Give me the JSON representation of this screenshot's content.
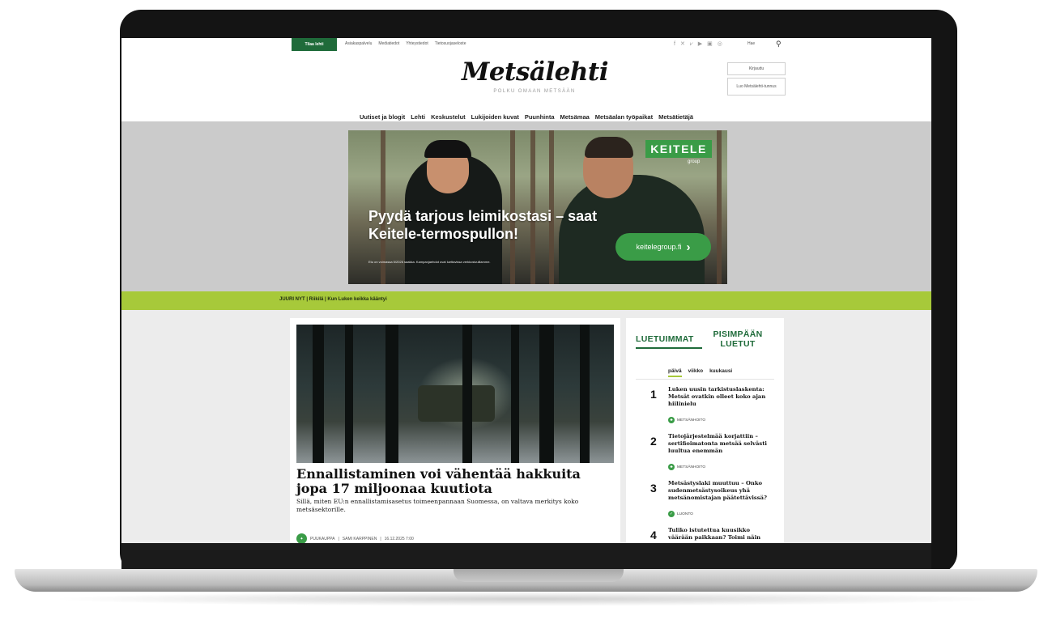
{
  "topbar": {
    "subscribe": "Tilaa lehti",
    "links": [
      "Asiakaspalvelu",
      "Mediatiedot",
      "Yhteystiedot",
      "Tietosuojaseloste"
    ],
    "social_icons": [
      "facebook-icon",
      "x-icon",
      "bluesky-icon",
      "youtube-icon",
      "linkedin-icon",
      "instagram-icon"
    ],
    "search_label": "Hae"
  },
  "header": {
    "logo": "Metsälehti",
    "tagline": "POLKU OMAAN METSÄÄN",
    "login": "Kirjaudu",
    "create_account": "Luo Metsälehti-tunnus"
  },
  "nav": [
    "Uutiset ja blogit",
    "Lehti",
    "Keskustelut",
    "Lukijoiden kuvat",
    "Puunhinta",
    "Metsämaa",
    "Metsäalan työpaikat",
    "Metsätietäjä"
  ],
  "ad": {
    "brand": "KEITELE",
    "brand_sub": "group",
    "headline": "Pyydä tarjous leimikostasi – saat Keitele-termospullon!",
    "fineprint": "Etu on voimassa 5/2026 saakka. Kampanjaehdot ovat luettavissa verkkosivuillamme.",
    "cta": "keitelegroup.fi",
    "accent": "#3a9c47"
  },
  "ticker": "JUURI NYT | Riikilä | Kun Luken keikka kääntyi",
  "article": {
    "title": "Ennallistaminen voi vähentää hakkuita jopa 17 miljoonaa kuutiota",
    "lead": "Sillä, miten EU:n ennallistamisasetus toimeenpannaan Suomessa, on valtava merkitys koko metsäsektorille.",
    "category": "PUUKAUPPA",
    "author": "SAMI KARPPINEN",
    "date": "16.12.2025 7:00"
  },
  "sidebar": {
    "tab_most_read": "LUETUIMMAT",
    "tab_longest_read": "PISIMPÄÄN LUETUT",
    "periods": [
      "päivä",
      "viikko",
      "kuukausi"
    ],
    "items": [
      {
        "num": "1",
        "title": "Luken uusin tarkistuslaskenta: Metsät ovatkin olleet koko ajan hiilinielu",
        "tag": "METSÄNHOITO"
      },
      {
        "num": "2",
        "title": "Tietojärjestelmää korjattiin – sertifioimatonta metsää selvästi luultua enemmän",
        "tag": "METSÄNHOITO"
      },
      {
        "num": "3",
        "title": "Metsästyslaki muuttuu – Onko sudenmetsästysoikeus yhä metsänomistajan päätettävissä?",
        "tag": "LUONTO"
      },
      {
        "num": "4",
        "title": "Tuliko istutettua kuusikko väärään paikkaan? Toimi näin",
        "tag": ""
      }
    ]
  },
  "colors": {
    "brand_green": "#1f6b3a",
    "ticker_lime": "#a7c93a"
  }
}
